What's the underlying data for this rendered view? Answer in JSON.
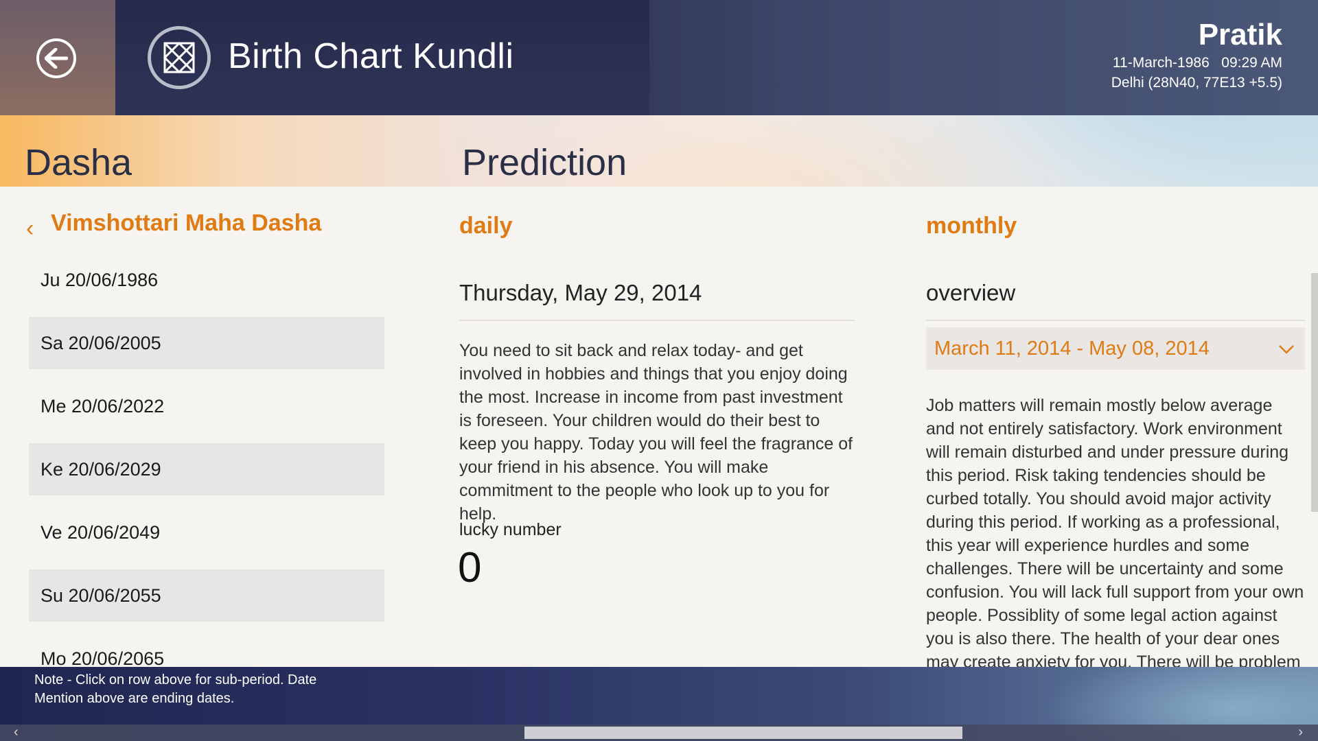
{
  "header": {
    "app_title": "Birth Chart Kundli",
    "back_icon": "arrow-left-circle-icon",
    "logo_icon": "kundli-chart-icon",
    "user": {
      "name": "Pratik",
      "dob": "11-March-1986   09:29 AM",
      "place": "Delhi (28N40, 77E13 +5.5)"
    }
  },
  "sections": {
    "dasha": "Dasha",
    "prediction": "Prediction"
  },
  "dasha": {
    "back_glyph": "‹",
    "title": "Vimshottari Maha Dasha",
    "items": [
      {
        "label": "Ju 20/06/1986",
        "shaded": false
      },
      {
        "label": "Sa 20/06/2005",
        "shaded": true
      },
      {
        "label": "Me 20/06/2022",
        "shaded": false
      },
      {
        "label": "Ke 20/06/2029",
        "shaded": true
      },
      {
        "label": "Ve 20/06/2049",
        "shaded": false
      },
      {
        "label": "Su 20/06/2055",
        "shaded": true
      },
      {
        "label": "Mo 20/06/2065",
        "shaded": false
      }
    ]
  },
  "daily": {
    "heading": "daily",
    "date": "Thursday, May 29, 2014",
    "text": "You need to sit back and relax today- and get involved in hobbies and things that you enjoy doing the most. Increase in income from past investment is foreseen. Your children would do their best to keep you happy. Today you will feel the fragrance of your friend in his absence. You will make commitment to the people who look up to you for help.",
    "lucky_label": "lucky number",
    "lucky_number": "0"
  },
  "monthly": {
    "heading": "monthly",
    "overview_label": "overview",
    "period": "March 11, 2014 - May 08, 2014",
    "text": "Job matters will remain mostly below average and not entirely satisfactory. Work environment will remain disturbed and under pressure during this period. Risk taking tendencies should be curbed totally. You should avoid major activity during this period. If working as a professional, this year will experience hurdles and some challenges. There will be uncertainty and some confusion. You will lack full support from your own people. Possiblity of some legal action against you is also there. The health of your dear ones may create anxiety for you.  There will be problem in the progeny during this period."
  },
  "footer": {
    "note": "Note - Click on row above for sub-period. Date Mention above are ending dates."
  },
  "colors": {
    "accent": "#e07b14",
    "header_bg": "#2b3052",
    "row_shade": "#e6e6e4"
  }
}
